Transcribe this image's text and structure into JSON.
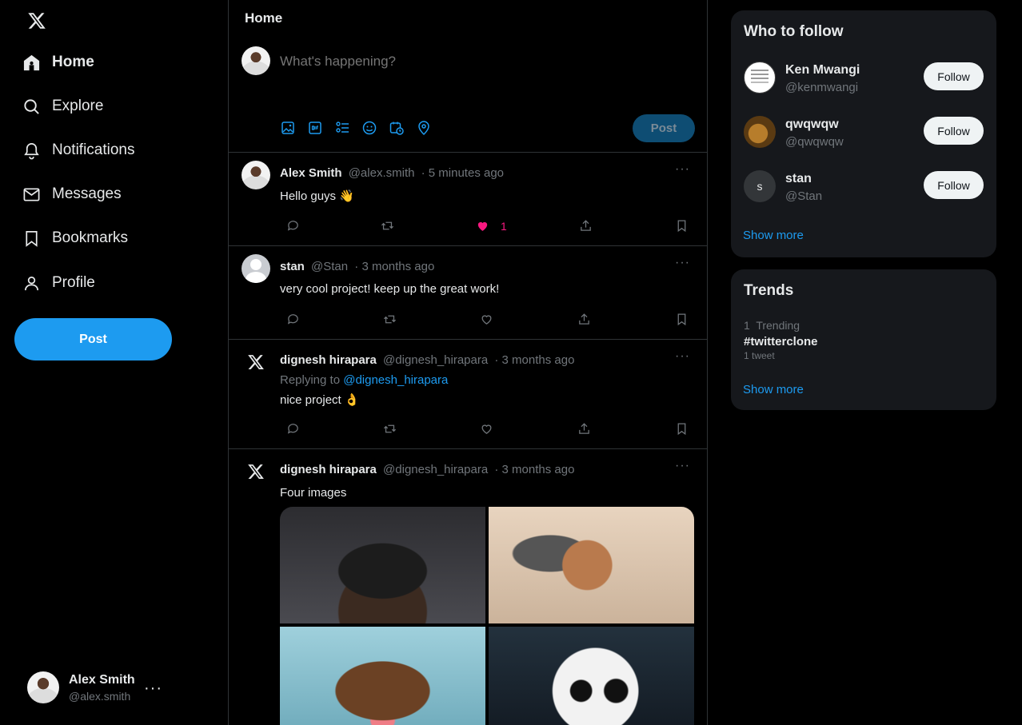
{
  "sidebar": {
    "items": [
      {
        "label": "Home",
        "icon": "home-icon"
      },
      {
        "label": "Explore",
        "icon": "search-icon"
      },
      {
        "label": "Notifications",
        "icon": "bell-icon"
      },
      {
        "label": "Messages",
        "icon": "mail-icon"
      },
      {
        "label": "Bookmarks",
        "icon": "bookmark-icon"
      },
      {
        "label": "Profile",
        "icon": "user-icon"
      }
    ],
    "post_label": "Post",
    "account": {
      "name": "Alex Smith",
      "handle": "@alex.smith"
    }
  },
  "header": {
    "title": "Home"
  },
  "composer": {
    "placeholder": "What's happening?",
    "post_label": "Post"
  },
  "tweets": [
    {
      "name": "Alex Smith",
      "handle": "@alex.smith",
      "time": "· 5 minutes ago",
      "text": "Hello guys 👋",
      "likes": "1"
    },
    {
      "name": "stan",
      "handle": "@Stan",
      "time": "· 3 months ago",
      "text": "very cool project! keep up the great work!"
    },
    {
      "name": "dignesh hirapara",
      "handle": "@dignesh_hirapara",
      "time": "· 3 months ago",
      "reply_prefix": "Replying to",
      "reply_to": "@dignesh_hirapara",
      "text": "nice project 👌"
    },
    {
      "name": "dignesh hirapara",
      "handle": "@dignesh_hirapara",
      "time": "· 3 months ago",
      "text": "Four images"
    }
  ],
  "who_to_follow": {
    "title": "Who to follow",
    "users": [
      {
        "name": "Ken Mwangi",
        "handle": "@kenmwangi",
        "button": "Follow"
      },
      {
        "name": "qwqwqw",
        "handle": "@qwqwqw",
        "button": "Follow"
      },
      {
        "name": "stan",
        "handle": "@Stan",
        "button": "Follow",
        "initial": "s"
      }
    ],
    "show_more": "Show more"
  },
  "trends": {
    "title": "Trends",
    "items": [
      {
        "rank": "1",
        "label": "Trending",
        "tag": "#twitterclone",
        "count": "1 tweet"
      }
    ],
    "show_more": "Show more"
  },
  "colors": {
    "accent": "#1d9bf0",
    "like": "#f91880",
    "background": "#000000",
    "card": "#16181c"
  }
}
